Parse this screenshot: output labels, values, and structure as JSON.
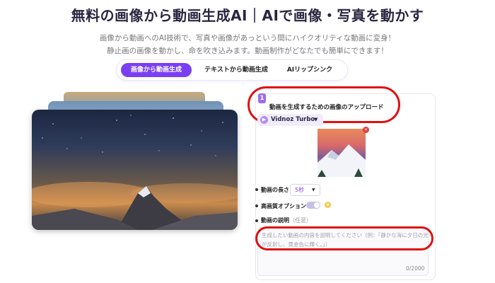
{
  "hero": {
    "title": "無料の画像から動画生成AI｜AIで画像・写真を動かす",
    "subtitle_line1": "画像から動画へのAI技術で、写真や画像があっという間にハイクオリティな動画に変身！",
    "subtitle_line2": "静止画の画像を動かし、命を吹き込みます。動画制作がどなたでも簡単にできます！"
  },
  "tabs": [
    {
      "label": "画像から動画生成",
      "active": true
    },
    {
      "label": "テキストから動画生成",
      "active": false
    },
    {
      "label": "AIリップシンク",
      "active": false
    }
  ],
  "panel": {
    "step_number": "1",
    "step_title": "動画を生成するための画像のアップロード",
    "model": "Vidnoz Turbo",
    "duration_label": "動画の長さ",
    "duration_value": "5秒",
    "quality_label": "高画質オプション",
    "description_label": "動画の説明",
    "description_optional": "（任意）",
    "description_placeholder": "生成したい動画の内容を説明してください（例：「静かな海に夕日の光が反射し、黄金色に輝く。」）",
    "counter": "0/2000"
  },
  "colors": {
    "accent": "#7b3ff2",
    "highlight": "#e01010"
  }
}
